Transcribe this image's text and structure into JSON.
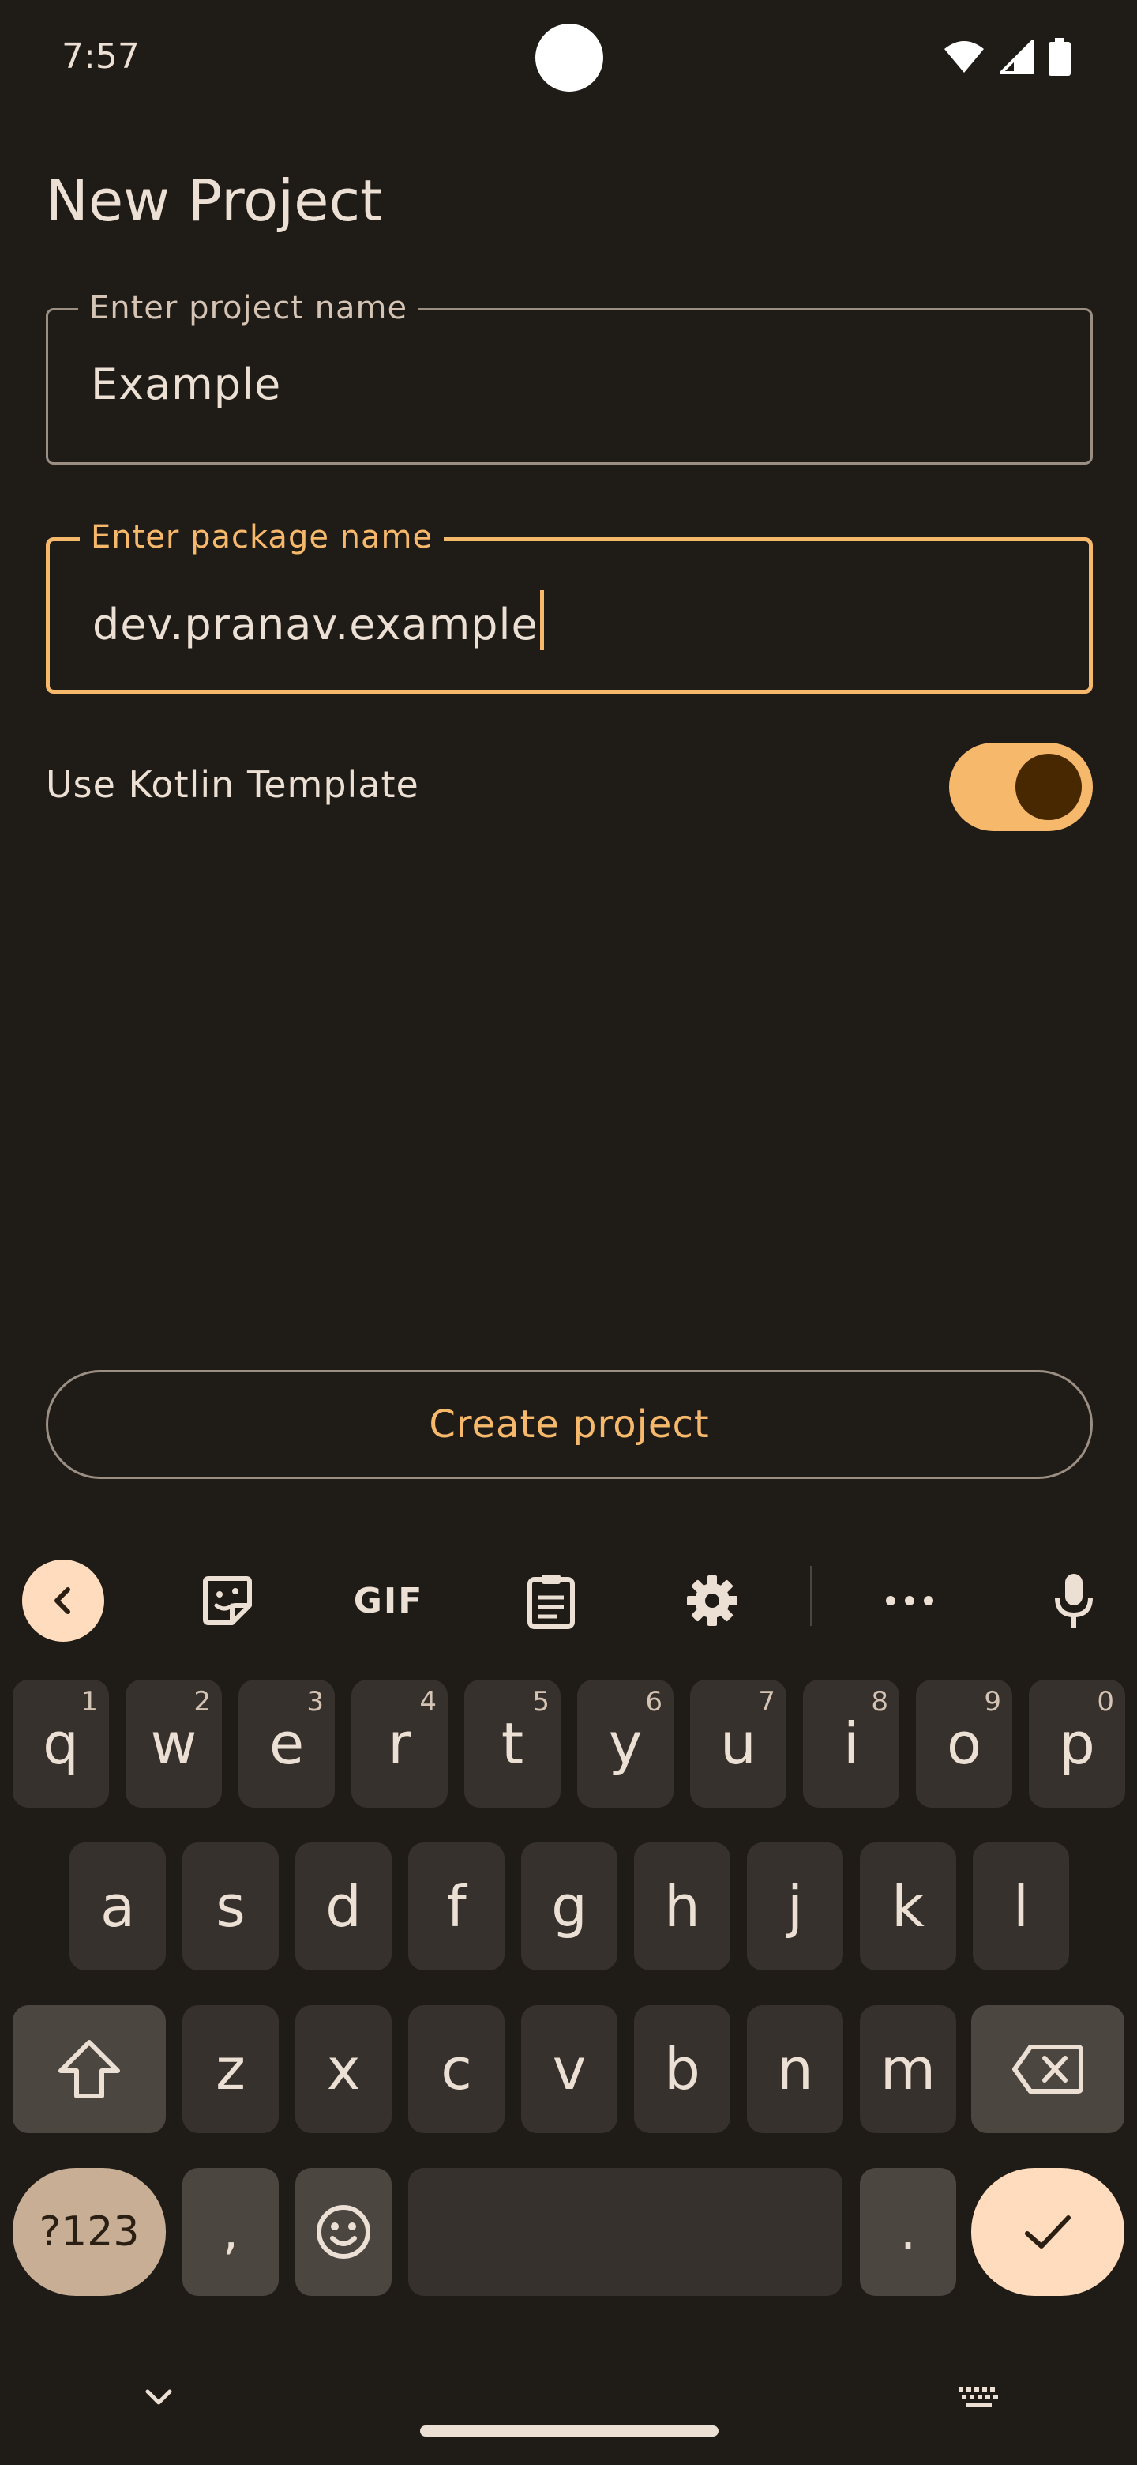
{
  "status_bar": {
    "time": "7:57"
  },
  "page": {
    "title": "New Project"
  },
  "project_name": {
    "label": "Enter project name",
    "value": "Example"
  },
  "package_name": {
    "label": "Enter package name",
    "value": "dev.pranav.example"
  },
  "kotlin_toggle": {
    "label": "Use Kotlin Template",
    "enabled": true
  },
  "create_button": {
    "label": "Create project"
  },
  "keyboard": {
    "toolbar": [
      "back-icon",
      "sticker-icon",
      "gif",
      "clipboard-icon",
      "gear-icon",
      "more-icon",
      "mic-icon"
    ],
    "gif_label": "GIF",
    "row1": [
      {
        "ch": "q",
        "num": "1"
      },
      {
        "ch": "w",
        "num": "2"
      },
      {
        "ch": "e",
        "num": "3"
      },
      {
        "ch": "r",
        "num": "4"
      },
      {
        "ch": "t",
        "num": "5"
      },
      {
        "ch": "y",
        "num": "6"
      },
      {
        "ch": "u",
        "num": "7"
      },
      {
        "ch": "i",
        "num": "8"
      },
      {
        "ch": "o",
        "num": "9"
      },
      {
        "ch": "p",
        "num": "0"
      }
    ],
    "row2": [
      "a",
      "s",
      "d",
      "f",
      "g",
      "h",
      "j",
      "k",
      "l"
    ],
    "row3": [
      "z",
      "x",
      "c",
      "v",
      "b",
      "n",
      "m"
    ],
    "sym_label": "?123",
    "comma": ",",
    "period": "."
  },
  "colors": {
    "background": "#1f1b17",
    "accent": "#f6b86b",
    "key": "#36312c",
    "key_mod": "#4c4640",
    "enter": "#ffdcbd"
  }
}
